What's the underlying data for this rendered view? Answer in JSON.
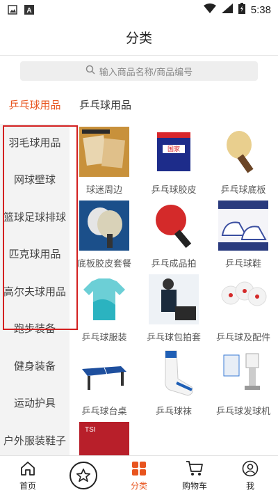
{
  "status_bar": {
    "time": "5:38",
    "left_icon": "image-icon",
    "keyboard_icon": "a-box-icon"
  },
  "header": {
    "title": "分类"
  },
  "search": {
    "placeholder": "输入商品名称/商品编号"
  },
  "sidebar": {
    "items": [
      {
        "label": "乒乓球用品",
        "active": true
      },
      {
        "label": "羽毛球用品"
      },
      {
        "label": "网球壁球"
      },
      {
        "label": "篮球足球排球"
      },
      {
        "label": "匹克球用品"
      },
      {
        "label": "高尔夫球用品"
      },
      {
        "label": "跑步装备"
      },
      {
        "label": "健身装备"
      },
      {
        "label": "运动护具"
      },
      {
        "label": "户外服装鞋子"
      }
    ]
  },
  "content": {
    "title": "乒乓球用品",
    "products": [
      {
        "label": "球迷周边",
        "icon": "fan-merch-image"
      },
      {
        "label": "乒乓球胶皮",
        "icon": "rubber-image"
      },
      {
        "label": "乒乓球底板",
        "icon": "blade-image"
      },
      {
        "label": "底板胶皮套餐",
        "icon": "combo-image"
      },
      {
        "label": "乒乓成品拍",
        "icon": "racket-image"
      },
      {
        "label": "乒乓球鞋",
        "icon": "shoes-image"
      },
      {
        "label": "乒乓球服装",
        "icon": "shirt-image"
      },
      {
        "label": "乒乓球包拍套",
        "icon": "bag-image"
      },
      {
        "label": "乒乓球及配件",
        "icon": "balls-image"
      },
      {
        "label": "乒乓球台桌",
        "icon": "table-image"
      },
      {
        "label": "乒乓球袜",
        "icon": "socks-image"
      },
      {
        "label": "乒乓球发球机",
        "icon": "robot-image"
      },
      {
        "label": "",
        "icon": "partial-image"
      }
    ]
  },
  "tabbar": {
    "tabs": [
      {
        "label": "首页",
        "icon": "home-icon"
      },
      {
        "label": "",
        "icon": "star-icon"
      },
      {
        "label": "分类",
        "icon": "category-icon",
        "active": true
      },
      {
        "label": "购物车",
        "icon": "cart-icon"
      },
      {
        "label": "我",
        "icon": "user-icon"
      }
    ]
  },
  "colors": {
    "accent": "#e8541e",
    "highlight_box": "#d32020"
  }
}
